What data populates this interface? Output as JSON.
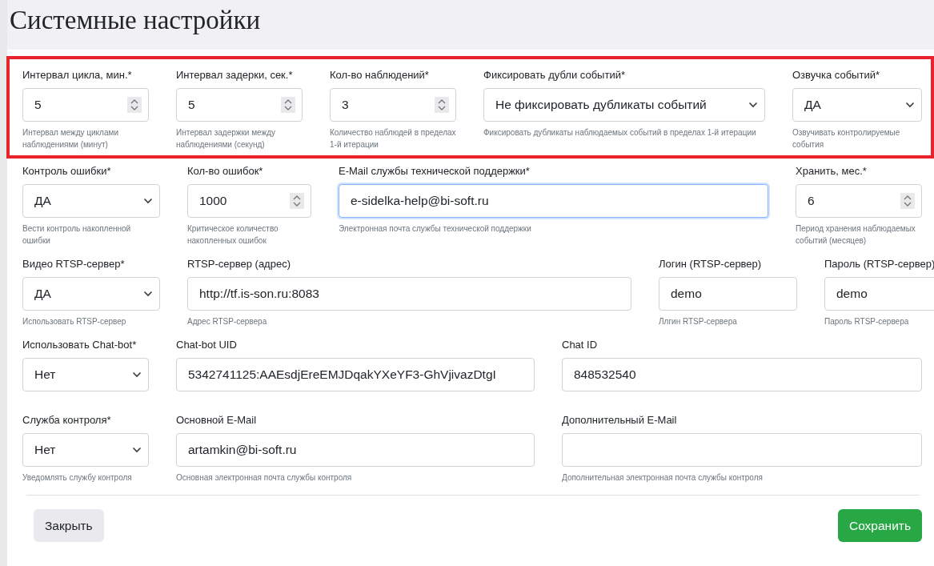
{
  "title": "Системные настройки",
  "rows": [
    {
      "highlighted": true,
      "fields": [
        {
          "kind": "number",
          "label": "Интервал цикла, мин.*",
          "value": "5",
          "help": "Интервал между циклами наблюдениями (минут)",
          "focused": false
        },
        {
          "kind": "number",
          "label": "Интервал задерки, сек.*",
          "value": "5",
          "help": "Интервал задержки между наблюдениями (секунд)",
          "focused": false
        },
        {
          "kind": "number",
          "label": "Кол-во наблюдений*",
          "value": "3",
          "help": "Количество наблюдей в пределах 1-й итерации",
          "focused": false
        },
        {
          "kind": "select",
          "label": "Фиксировать дубли событий*",
          "value": "Не фиксировать дубликаты событий",
          "help": "Фиксировать дубликаты наблюдаемых событий в пределах 1-й итерации",
          "focused": false
        },
        {
          "kind": "select",
          "label": "Озвучка событий*",
          "value": "ДА",
          "help": "Озвучивать контролируемые события",
          "focused": false
        }
      ]
    },
    {
      "highlighted": false,
      "fields": [
        {
          "kind": "select",
          "label": "Контроль ошибки*",
          "value": "ДА",
          "help": "Вести контроль накопленной ошибки",
          "focused": false
        },
        {
          "kind": "number",
          "label": "Кол-во ошибок*",
          "value": "1000",
          "help": "Критическое количество накопленных ошибок",
          "focused": false
        },
        {
          "kind": "text",
          "label": "E-Mail службы технической поддержки*",
          "value": "e-sidelka-help@bi-soft.ru",
          "help": "Электронная почта службы технической поддержки",
          "focused": true
        },
        {
          "kind": "number",
          "label": "Хранить, мес.*",
          "value": "6",
          "help": "Период хранения наблюдаемых событий (месяцев)",
          "focused": false
        }
      ]
    },
    {
      "highlighted": false,
      "fields": [
        {
          "kind": "select",
          "label": "Видео RTSP-сервер*",
          "value": "ДА",
          "help": "Использовать RTSP-сервер",
          "focused": false
        },
        {
          "kind": "text",
          "label": "RTSP-сервер (адрес)",
          "value": "http://tf.is-son.ru:8083",
          "help": "Адрес RTSP-сервера",
          "focused": false
        },
        {
          "kind": "text",
          "label": "Логин (RTSP-сервер)",
          "value": "demo",
          "help": "Ллгин RTSP-сервера",
          "focused": false
        },
        {
          "kind": "text",
          "label": "Пароль (RTSP-сервер)",
          "value": "demo",
          "help": "Пароль RTSP-сервера",
          "focused": false
        }
      ]
    },
    {
      "highlighted": false,
      "fields": [
        {
          "kind": "select",
          "label": "Использовать Chat-bot*",
          "value": "Нет",
          "focused": false
        },
        {
          "kind": "text",
          "label": "Chat-bot UID",
          "value": "5342741125:AAEsdjEreEMJDqakYXeYF3-GhVjivazDtgI",
          "focused": false
        },
        {
          "kind": "text",
          "label": "Chat ID",
          "value": "848532540",
          "focused": false
        }
      ]
    },
    {
      "highlighted": false,
      "fields": [
        {
          "kind": "select",
          "label": "Служба контроля*",
          "value": "Нет",
          "help": "Уведомлять службу контроля",
          "focused": false
        },
        {
          "kind": "text",
          "label": "Основной E-Mail",
          "value": "artamkin@bi-soft.ru",
          "help": "Основная электронная почта службы контроля",
          "focused": false
        },
        {
          "kind": "text",
          "label": "Дополнительный E-Mail",
          "help": "Дополнительная электронная почта службы контроля",
          "focused": false
        }
      ]
    }
  ],
  "buttons": [
    {
      "label": "Закрыть",
      "kind": "secondary"
    },
    {
      "label": "Сохранить",
      "kind": "success"
    }
  ]
}
